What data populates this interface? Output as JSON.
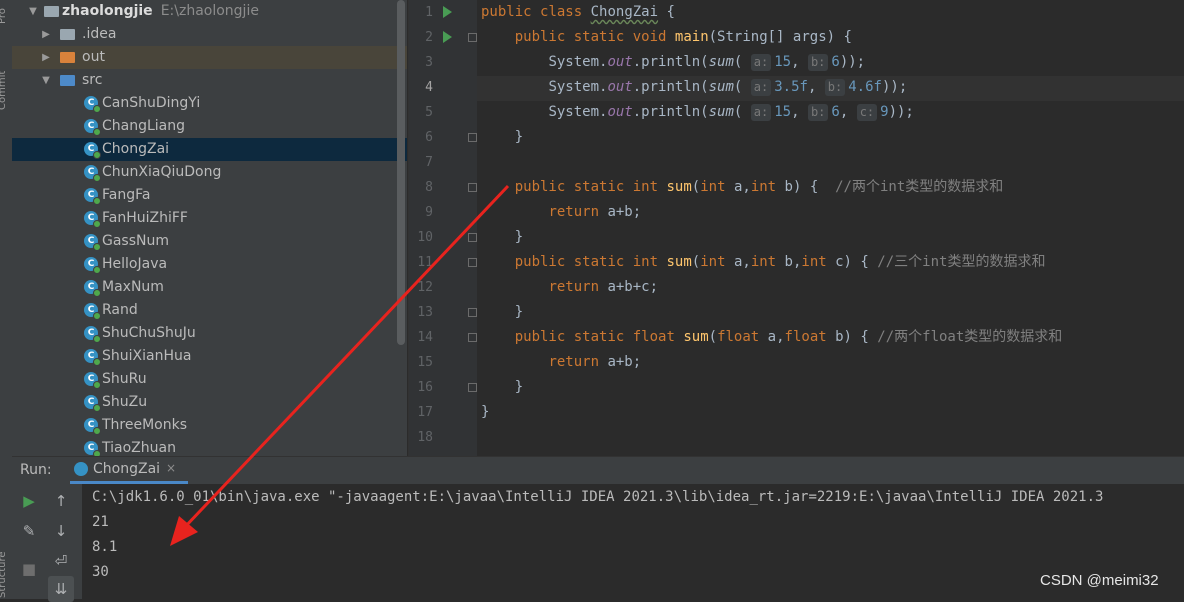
{
  "left_strip": {
    "top_label": "Pro",
    "commit_label": "Commit",
    "structure_label": "Structure"
  },
  "project": {
    "root_name": "zhaolongjie",
    "root_path": "E:\\zhaolongjie",
    "folders": [
      {
        "name": ".idea",
        "color": "#9aa7b0"
      },
      {
        "name": "out",
        "color": "#d9823b"
      },
      {
        "name": "src",
        "color": "#4d8ac9"
      }
    ],
    "classes": [
      "CanShuDingYi",
      "ChangLiang",
      "ChongZai",
      "ChunXiaQiuDong",
      "FangFa",
      "FanHuiZhiFF",
      "GassNum",
      "HelloJava",
      "MaxNum",
      "Rand",
      "ShuChuShuJu",
      "ShuiXianHua",
      "ShuRu",
      "ShuZu",
      "ThreeMonks",
      "TiaoZhuan"
    ],
    "selected_class": "ChongZai",
    "class_icon_letter": "C"
  },
  "editor": {
    "line_numbers": [
      "1",
      "2",
      "3",
      "4",
      "5",
      "6",
      "7",
      "8",
      "9",
      "10",
      "11",
      "12",
      "13",
      "14",
      "15",
      "16",
      "17",
      "18"
    ],
    "current_line": "4",
    "tokens": {
      "public": "public",
      "class": "class",
      "static": "static",
      "void": "void",
      "int": "int",
      "float": "float",
      "return": "return",
      "class_name": "ChongZai",
      "main": "main",
      "main_params": "(String[] args) {",
      "system": "System.",
      "out": "out",
      "println": ".println(",
      "sum": "sum",
      "hint_a": "a:",
      "hint_b": "b:",
      "hint_c": "c:",
      "v15": "15",
      "v6": "6",
      "v35f": "3.5f",
      "v46f": "4.6f",
      "v9": "9",
      "comma": ", ",
      "close_call": "));",
      "open_brace": " {",
      "close_brace": "}",
      "params_ab_int_open": "(",
      "param_a": " a,",
      "param_b_close": " b) {",
      "param_b": " b,",
      "param_c_close": " c) {",
      "ret_ab": " a+b;",
      "ret_abc": " a+b+c;",
      "comment_1": "//两个int类型的数据求和",
      "comment_2": "//三个int类型的数据求和",
      "comment_3": "//两个float类型的数据求和"
    }
  },
  "run_panel": {
    "label": "Run:",
    "tab_name": "ChongZai",
    "tab_close": "×",
    "command": "C:\\jdk1.6.0_01\\bin\\java.exe \"-javaagent:E:\\javaa\\IntelliJ IDEA 2021.3\\lib\\idea_rt.jar=2219:E:\\javaa\\IntelliJ IDEA 2021.3",
    "output": [
      "21",
      "8.1",
      "30"
    ]
  },
  "watermark": "CSDN @meimi32",
  "colors": {
    "arrow": "#e8231e",
    "accent": "#4a88c7",
    "run_green": "#499c54"
  }
}
